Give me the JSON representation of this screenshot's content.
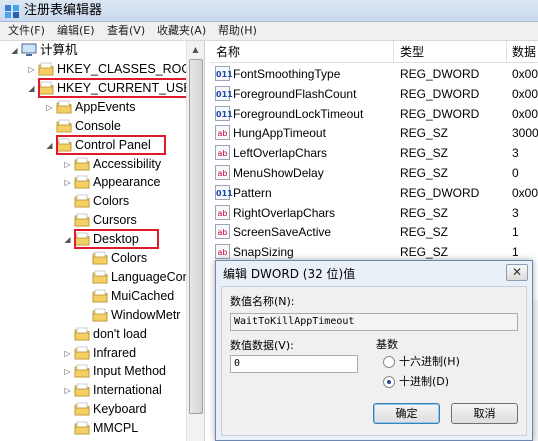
{
  "window": {
    "title": "注册表编辑器"
  },
  "menu": [
    "文件(F)",
    "编辑(E)",
    "查看(V)",
    "收藏夹(A)",
    "帮助(H)"
  ],
  "tree": {
    "root": "计算机",
    "nodes": [
      {
        "label": "HKEY_CLASSES_ROOT",
        "level": 1,
        "arrow": "▷"
      },
      {
        "label": "HKEY_CURRENT_USER",
        "level": 1,
        "arrow": "◢",
        "highlight": true
      },
      {
        "label": "AppEvents",
        "level": 2,
        "arrow": "▷"
      },
      {
        "label": "Console",
        "level": 2,
        "arrow": ""
      },
      {
        "label": "Control Panel",
        "level": 2,
        "arrow": "◢",
        "highlight": true
      },
      {
        "label": "Accessibility",
        "level": 3,
        "arrow": "▷"
      },
      {
        "label": "Appearance",
        "level": 3,
        "arrow": "▷"
      },
      {
        "label": "Colors",
        "level": 3,
        "arrow": ""
      },
      {
        "label": "Cursors",
        "level": 3,
        "arrow": ""
      },
      {
        "label": "Desktop",
        "level": 3,
        "arrow": "◢",
        "highlight": true
      },
      {
        "label": "Colors",
        "level": 4,
        "arrow": ""
      },
      {
        "label": "LanguageCor",
        "level": 4,
        "arrow": ""
      },
      {
        "label": "MuiCached",
        "level": 4,
        "arrow": ""
      },
      {
        "label": "WindowMetr",
        "level": 4,
        "arrow": ""
      },
      {
        "label": "don't load",
        "level": 3,
        "arrow": ""
      },
      {
        "label": "Infrared",
        "level": 3,
        "arrow": "▷"
      },
      {
        "label": "Input Method",
        "level": 3,
        "arrow": "▷"
      },
      {
        "label": "International",
        "level": 3,
        "arrow": "▷"
      },
      {
        "label": "Keyboard",
        "level": 3,
        "arrow": ""
      },
      {
        "label": "MMCPL",
        "level": 3,
        "arrow": ""
      }
    ]
  },
  "list": {
    "headers": {
      "name": "名称",
      "type": "类型",
      "data": "数据"
    },
    "rows": [
      {
        "icon": "dword",
        "name": "FontSmoothingType",
        "type": "REG_DWORD",
        "data": "0x00"
      },
      {
        "icon": "dword",
        "name": "ForegroundFlashCount",
        "type": "REG_DWORD",
        "data": "0x00"
      },
      {
        "icon": "dword",
        "name": "ForegroundLockTimeout",
        "type": "REG_DWORD",
        "data": "0x00"
      },
      {
        "icon": "sz",
        "name": "HungAppTimeout",
        "type": "REG_SZ",
        "data": "3000"
      },
      {
        "icon": "sz",
        "name": "LeftOverlapChars",
        "type": "REG_SZ",
        "data": "3"
      },
      {
        "icon": "sz",
        "name": "MenuShowDelay",
        "type": "REG_SZ",
        "data": "0"
      },
      {
        "icon": "dword",
        "name": "Pattern",
        "type": "REG_DWORD",
        "data": "0x00"
      },
      {
        "icon": "sz",
        "name": "RightOverlapChars",
        "type": "REG_SZ",
        "data": "3"
      },
      {
        "icon": "sz",
        "name": "ScreenSaveActive",
        "type": "REG_SZ",
        "data": "1"
      },
      {
        "icon": "sz",
        "name": "SnapSizing",
        "type": "REG_SZ",
        "data": "1"
      }
    ]
  },
  "dialog": {
    "title": "编辑 DWORD (32 位)值",
    "close": "✕",
    "name_label": "数值名称(N):",
    "name_value": "WaitToKillAppTimeout",
    "data_label": "数值数据(V):",
    "data_value": "0",
    "base_label": "基数",
    "hex_label": "十六进制(H)",
    "dec_label": "十进制(D)",
    "selected_base": "dec",
    "ok": "确定",
    "cancel": "取消"
  },
  "icons": {
    "app": "regedit-icon",
    "folder": "folder-icon",
    "computer": "computer-icon"
  },
  "colors": {
    "highlight": "#e0192b",
    "folder": "#f3cf64",
    "dialog_bg": "#eaf0f8"
  }
}
